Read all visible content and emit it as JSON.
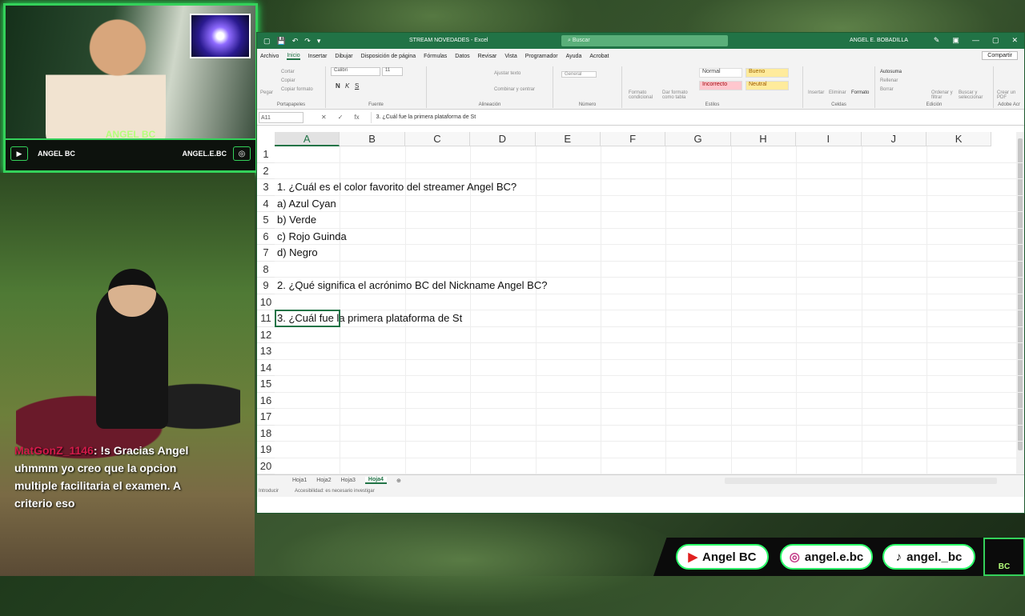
{
  "webcam": {
    "streamer_name": "ANGEL BC",
    "youtube_handle": "ANGEL BC",
    "instagram_handle": "ANGEL.E.BC"
  },
  "chat": {
    "username": "MatGonZ_1146",
    "message": ": !s Gracias Angel uhmmm yo creo que la opcion multiple facilitaria el examen. A criterio eso"
  },
  "excel": {
    "title": "STREAM NOVEDADES - Excel",
    "search_placeholder": "Buscar",
    "user": "ANGEL E. BOBADILLA",
    "menu": [
      "Archivo",
      "Inicio",
      "Insertar",
      "Dibujar",
      "Disposición de página",
      "Fórmulas",
      "Datos",
      "Revisar",
      "Vista",
      "Programador",
      "Ayuda",
      "Acrobat"
    ],
    "share": "Compartir",
    "ribbon": {
      "groups": [
        "Portapapeles",
        "Fuente",
        "Alineación",
        "Número",
        "Estilos",
        "Celdas",
        "Edición",
        "Adobe Acr"
      ],
      "paste": "Pegar",
      "cut": "Cortar",
      "copy": "Copiar",
      "format_copy": "Copiar formato",
      "font": "Calibri",
      "size": "11",
      "wrap_text": "Ajustar texto",
      "merge": "Combinar y centrar",
      "number_format": "General",
      "cond_format": "Formato condicional",
      "table_format": "Dar formato como tabla",
      "style_normal": "Normal",
      "style_good": "Bueno",
      "style_bad": "Incorrecto",
      "style_neutral": "Neutral",
      "insert": "Insertar",
      "delete": "Eliminar",
      "format": "Formato",
      "autosum": "Autosuma",
      "fill": "Rellenar",
      "clear": "Borrar",
      "sort": "Ordenar y filtrar",
      "find": "Buscar y seleccionar",
      "create_pdf": "Crear un PDF"
    },
    "name_box": "A11",
    "formula": "3. ¿Cuál fue la primera plataforma de St",
    "columns": [
      "A",
      "B",
      "C",
      "D",
      "E",
      "F",
      "G",
      "H",
      "I",
      "J",
      "K"
    ],
    "rows": [
      "1",
      "2",
      "3",
      "4",
      "5",
      "6",
      "7",
      "8",
      "9",
      "10",
      "11",
      "12",
      "13",
      "14",
      "15",
      "16",
      "17",
      "18",
      "19",
      "20"
    ],
    "cells": {
      "r3": "1. ¿Cuál es el color favorito del streamer Angel BC?",
      "r4": "a) Azul Cyan",
      "r5": "b) Verde",
      "r6": "c) Rojo Guinda",
      "r7": "d) Negro",
      "r9": "2. ¿Qué significa el acrónimo BC del Nickname Angel BC?",
      "r11": "3. ¿Cuál fue la primera plataforma de St"
    },
    "sheets": [
      "Hoja1",
      "Hoja2",
      "Hoja3",
      "Hoja4"
    ],
    "active_sheet": "Hoja4",
    "status_mode": "Introducir",
    "status_accessibility": "Accesibilidad: es necesario investigar"
  },
  "socials": {
    "youtube": "Angel BC",
    "instagram": "angel.e.bc",
    "tiktok": "angel._bc",
    "logo": "BC"
  },
  "colors": {
    "excel_green": "#217346",
    "neon_green": "#34d15a",
    "chat_user": "#d41a4a"
  }
}
